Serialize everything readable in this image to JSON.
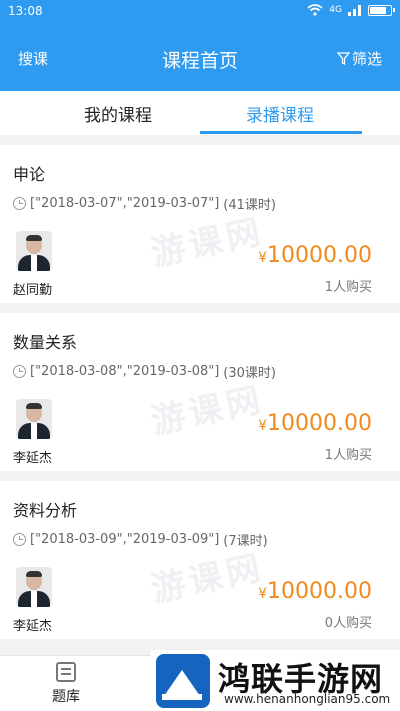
{
  "status": {
    "time": "13:08",
    "net": "4G",
    "signal": "ill"
  },
  "appbar": {
    "left": "搜课",
    "title": "课程首页",
    "right": "筛选",
    "right_icon": "filter-icon"
  },
  "tabs": [
    {
      "label": "我的课程",
      "active": false
    },
    {
      "label": "录播课程",
      "active": true
    }
  ],
  "courses": [
    {
      "title": "申论",
      "dates": "[\"2018-03-07\",\"2019-03-07\"]",
      "hours": "(41课时)",
      "teacher": "赵同勤",
      "currency": "¥",
      "price": "10000.00",
      "buyers": "1人购买"
    },
    {
      "title": "数量关系",
      "dates": "[\"2018-03-08\",\"2019-03-08\"]",
      "hours": "(30课时)",
      "teacher": "李延杰",
      "currency": "¥",
      "price": "10000.00",
      "buyers": "1人购买"
    },
    {
      "title": "资料分析",
      "dates": "[\"2018-03-09\",\"2019-03-09\"]",
      "hours": "(7课时)",
      "teacher": "李延杰",
      "currency": "¥",
      "price": "10000.00",
      "buyers": "0人购买"
    }
  ],
  "watermark": "游课网",
  "bottom_nav": {
    "label": "题库",
    "icon": "question-bank-icon"
  },
  "banner": {
    "title": "鸿联手游网",
    "url": "www.henanhonglian95.com"
  },
  "colors": {
    "primary": "#2f9bf0",
    "price": "#f08a1c"
  }
}
